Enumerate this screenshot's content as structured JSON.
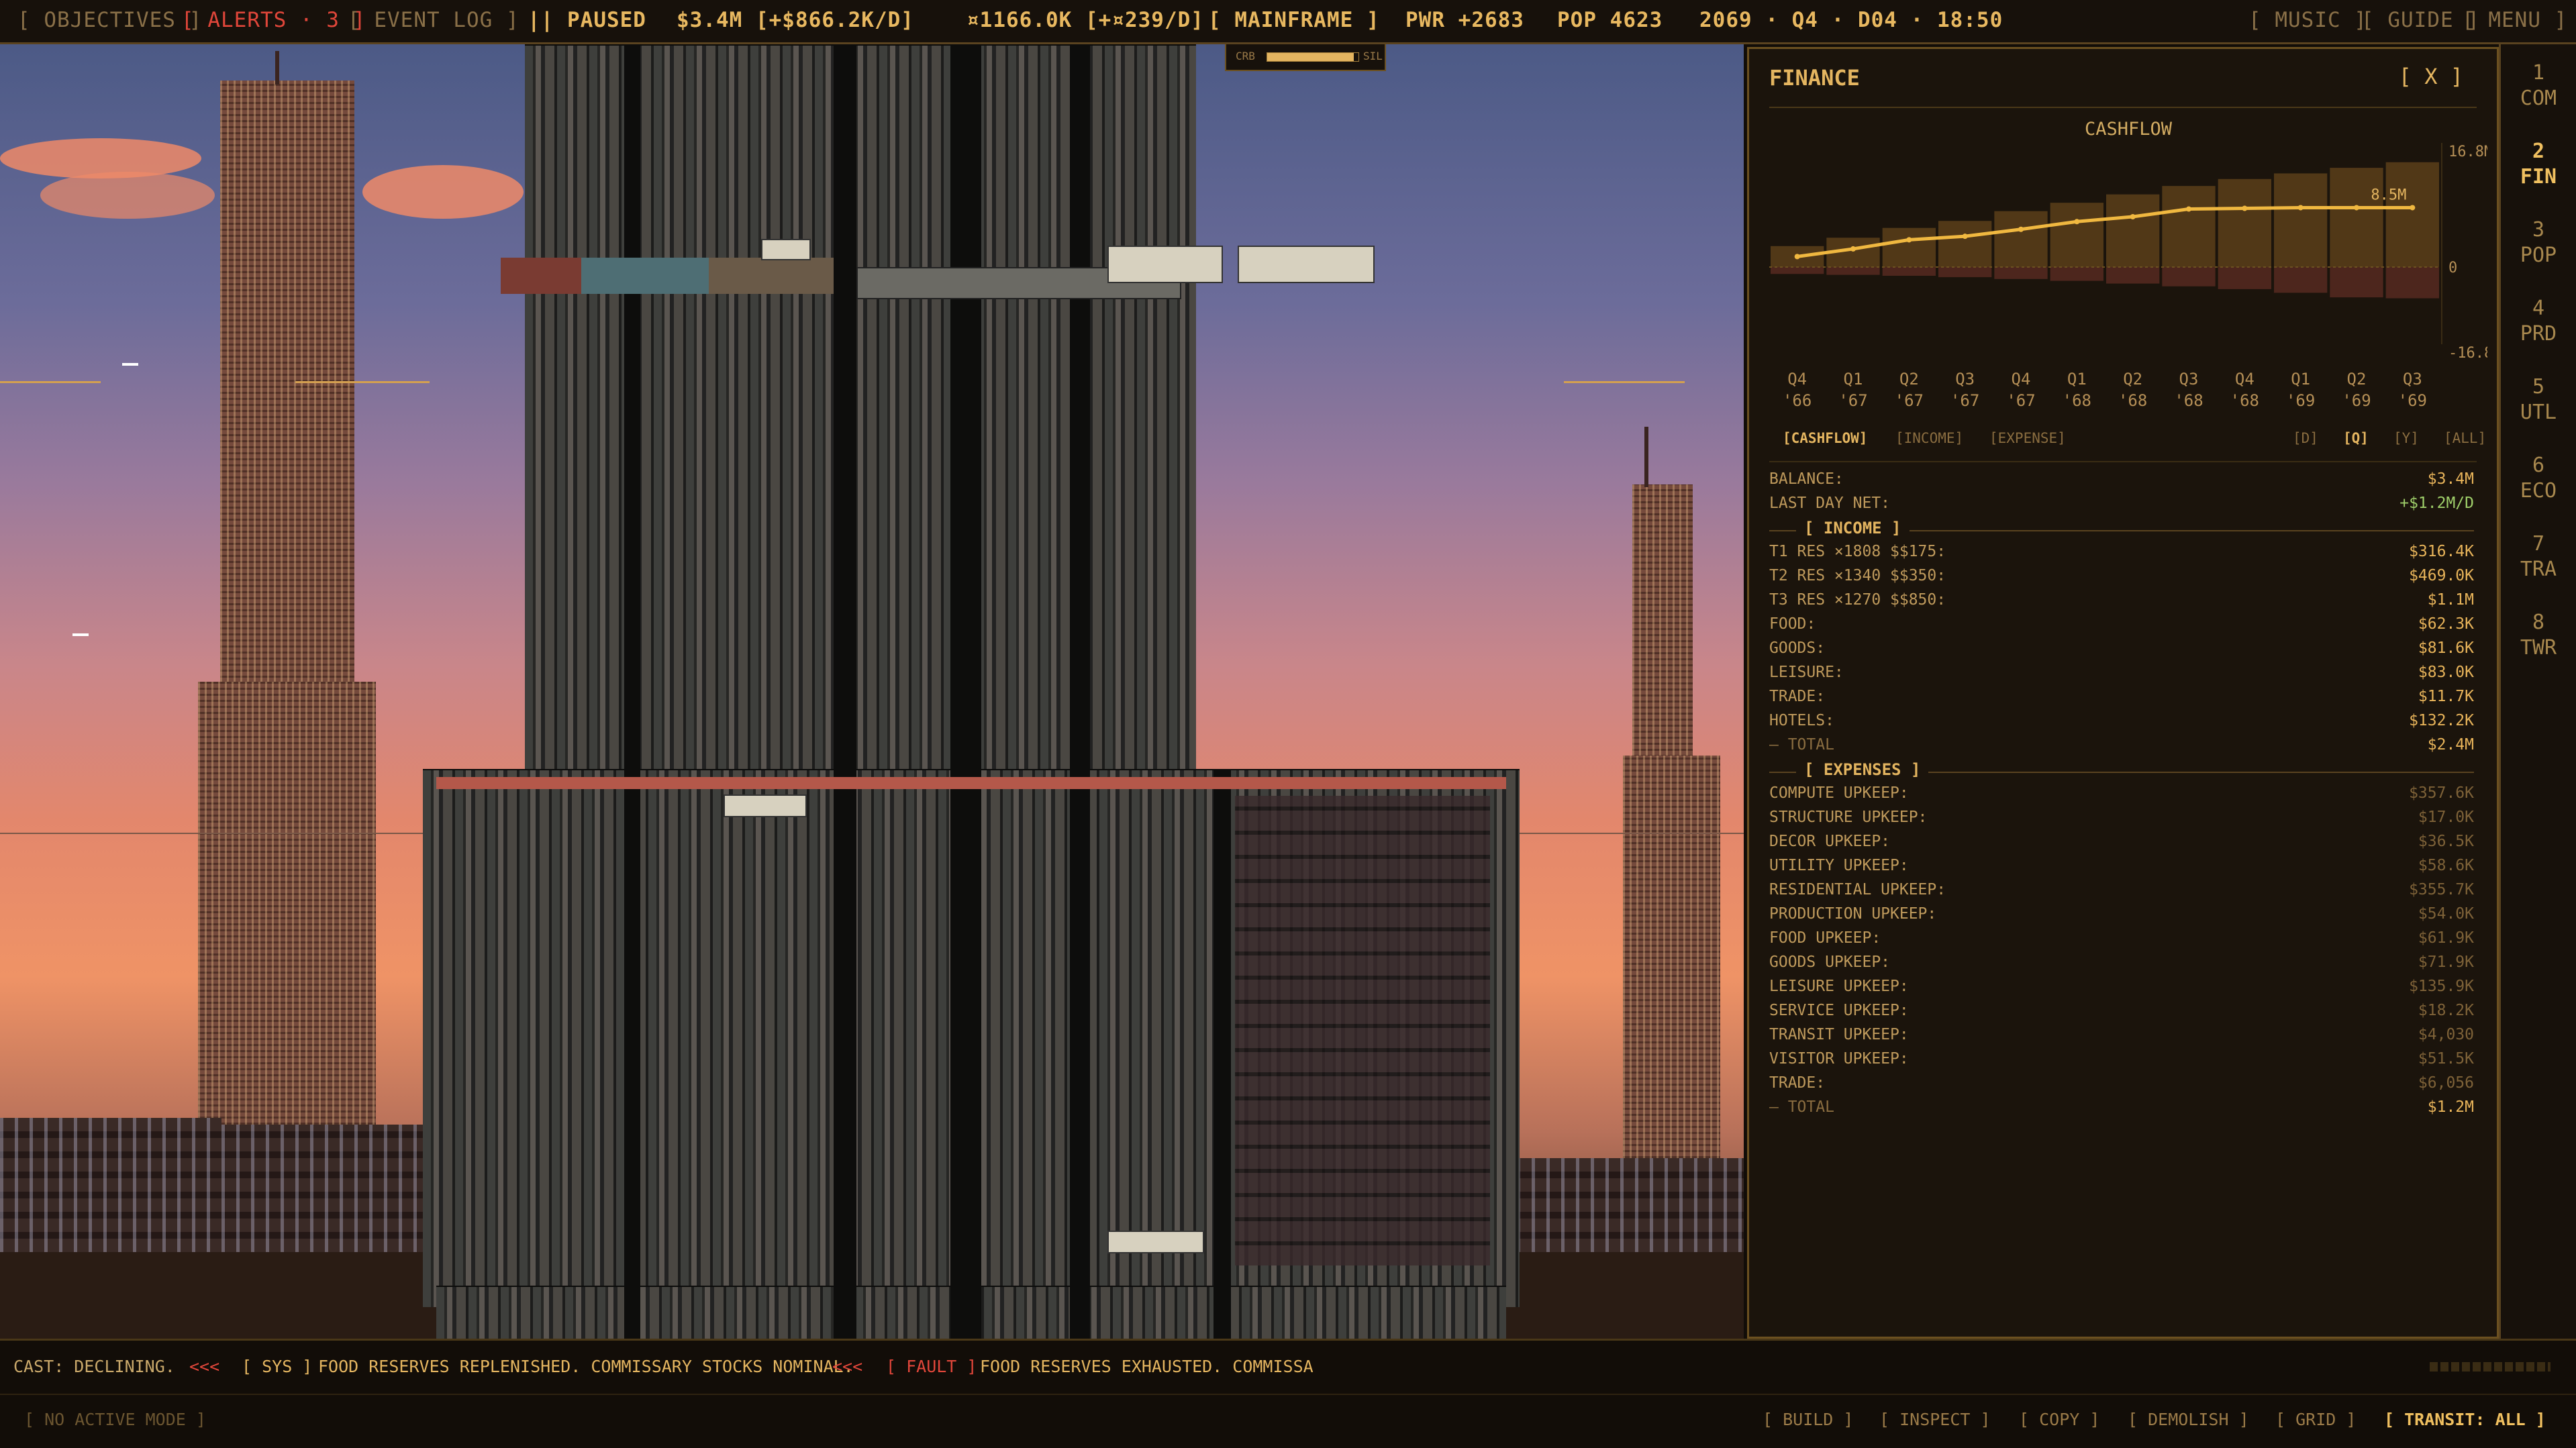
{
  "topbar": {
    "objectives": "[ OBJECTIVES ]",
    "alerts": "[ ALERTS · 3 ]",
    "event_log": "[ EVENT LOG ]",
    "paused": "|| PAUSED",
    "money": "$3.4M [+$866.2K/D]",
    "compute": "¤1166.0K [+¤239/D]",
    "mode": "[ MAINFRAME ]",
    "power": "PWR +2683",
    "population": "POP 4623",
    "date": "2069 · Q4 · D04 · 18:50",
    "music": "[ MUSIC ]",
    "guide": "[ GUIDE ]",
    "menu": "[ MENU ]",
    "carbon_left": "CRB",
    "carbon_right": "SIL",
    "carbon_level": 0.95
  },
  "finance": {
    "title": "FINANCE",
    "close": "[ X ]",
    "chart_title": "CASHFLOW",
    "tabs": {
      "cashflow": "[CASHFLOW]",
      "income": "[INCOME]",
      "expense": "[EXPENSE]",
      "d": "[D]",
      "q": "[Q]",
      "y": "[Y]",
      "all": "[ALL]"
    },
    "balance_label": "BALANCE:",
    "balance_value": "$3.4M",
    "lastday_label": "LAST DAY NET:",
    "lastday_value": "+$1.2M/D",
    "income_header": "[ INCOME ]",
    "income": [
      {
        "label": "T1 RES ×1808 $$175:",
        "value": "$316.4K"
      },
      {
        "label": "T2 RES ×1340 $$350:",
        "value": "$469.0K"
      },
      {
        "label": "T3 RES ×1270 $$850:",
        "value": "$1.1M"
      },
      {
        "label": "FOOD:",
        "value": "$62.3K"
      },
      {
        "label": "GOODS:",
        "value": "$81.6K"
      },
      {
        "label": "LEISURE:",
        "value": "$83.0K"
      },
      {
        "label": "TRADE:",
        "value": "$11.7K"
      },
      {
        "label": "HOTELS:",
        "value": "$132.2K"
      }
    ],
    "income_total_label": "— TOTAL",
    "income_total_value": "$2.4M",
    "expenses_header": "[ EXPENSES ]",
    "expenses": [
      {
        "label": "COMPUTE UPKEEP:",
        "value": "$357.6K"
      },
      {
        "label": "STRUCTURE UPKEEP:",
        "value": "$17.0K"
      },
      {
        "label": "DECOR UPKEEP:",
        "value": "$36.5K"
      },
      {
        "label": "UTILITY UPKEEP:",
        "value": "$58.6K"
      },
      {
        "label": "RESIDENTIAL UPKEEP:",
        "value": "$355.7K"
      },
      {
        "label": "PRODUCTION UPKEEP:",
        "value": "$54.0K"
      },
      {
        "label": "FOOD UPKEEP:",
        "value": "$61.9K"
      },
      {
        "label": "GOODS UPKEEP:",
        "value": "$71.9K"
      },
      {
        "label": "LEISURE UPKEEP:",
        "value": "$135.9K"
      },
      {
        "label": "SERVICE UPKEEP:",
        "value": "$18.2K"
      },
      {
        "label": "TRANSIT UPKEEP:",
        "value": "$4,030"
      },
      {
        "label": "VISITOR UPKEEP:",
        "value": "$51.5K"
      },
      {
        "label": "TRADE:",
        "value": "$6,056"
      }
    ],
    "expenses_total_label": "— TOTAL",
    "expenses_total_value": "$1.2M"
  },
  "chart_data": {
    "type": "line",
    "title": "CASHFLOW",
    "categories": [
      [
        "Q4",
        "'66"
      ],
      [
        "Q1",
        "'67"
      ],
      [
        "Q2",
        "'67"
      ],
      [
        "Q3",
        "'67"
      ],
      [
        "Q4",
        "'67"
      ],
      [
        "Q1",
        "'68"
      ],
      [
        "Q2",
        "'68"
      ],
      [
        "Q3",
        "'68"
      ],
      [
        "Q4",
        "'68"
      ],
      [
        "Q1",
        "'69"
      ],
      [
        "Q2",
        "'69"
      ],
      [
        "Q3",
        "'69"
      ]
    ],
    "series": [
      {
        "values": [
          1.5,
          2.6,
          3.9,
          4.4,
          5.4,
          6.5,
          7.2,
          8.3,
          8.4,
          8.5,
          8.5,
          8.5
        ]
      }
    ],
    "income_bars": [
      3.0,
      4.2,
      5.6,
      6.6,
      8.0,
      9.2,
      10.4,
      11.6,
      12.6,
      13.4,
      14.2,
      15.0
    ],
    "expense_bars": [
      -1.5,
      -1.7,
      -1.9,
      -2.2,
      -2.6,
      -3.0,
      -3.6,
      -4.2,
      -4.8,
      -5.6,
      -6.6,
      -6.8
    ],
    "end_label": "8.5M",
    "y_ticks": [
      "16.8M",
      "0",
      "-16.8M"
    ],
    "ylim": [
      -16.8,
      16.8
    ]
  },
  "sidebar": [
    {
      "num": "1",
      "label": "COM"
    },
    {
      "num": "2",
      "label": "FIN"
    },
    {
      "num": "3",
      "label": "POP"
    },
    {
      "num": "4",
      "label": "PRD"
    },
    {
      "num": "5",
      "label": "UTL"
    },
    {
      "num": "6",
      "label": "ECO"
    },
    {
      "num": "7",
      "label": "TRA"
    },
    {
      "num": "8",
      "label": "TWR"
    }
  ],
  "ticker": {
    "left": "CAST: DECLINING.",
    "sep1": "<<<",
    "sys_tag": "[ SYS ]",
    "sys_msg": "FOOD RESERVES REPLENISHED. COMMISSARY STOCKS NOMINAL.",
    "sep2": "<<<",
    "fault_tag": "[ FAULT ]",
    "fault_msg": "FOOD RESERVES EXHAUSTED. COMMISSA"
  },
  "toolbar": {
    "mode": "[ NO ACTIVE MODE ]",
    "build": "[ BUILD ]",
    "inspect": "[ INSPECT ]",
    "copy": "[ COPY ]",
    "demolish": "[ DEMOLISH ]",
    "grid": "[ GRID ]",
    "transit": "[ TRANSIT: ALL ]"
  }
}
